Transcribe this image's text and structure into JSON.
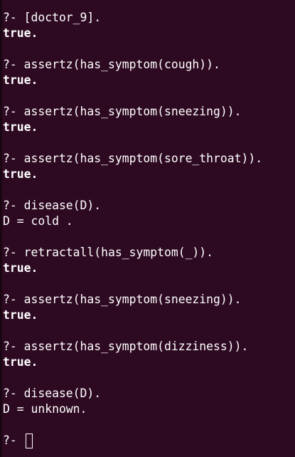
{
  "terminal": {
    "blocks": [
      {
        "query": "?- [doctor_9].",
        "result": "true."
      },
      {
        "query": "?- assertz(has_symptom(cough)).",
        "result": "true."
      },
      {
        "query": "?- assertz(has_symptom(sneezing)).",
        "result": "true."
      },
      {
        "query": "?- assertz(has_symptom(sore_throat)).",
        "result": "true."
      },
      {
        "query": "?- disease(D).",
        "answer": "D = cold ."
      },
      {
        "query": "?- retractall(has_symptom(_)).",
        "result": "true."
      },
      {
        "query": "?- assertz(has_symptom(sneezing)).",
        "result": "true."
      },
      {
        "query": "?- assertz(has_symptom(dizziness)).",
        "result": "true."
      },
      {
        "query": "?- disease(D).",
        "answer": "D = unknown."
      }
    ],
    "prompt": "?- ",
    "colors": {
      "background": "#2e0a22",
      "text": "#ffffff"
    }
  }
}
